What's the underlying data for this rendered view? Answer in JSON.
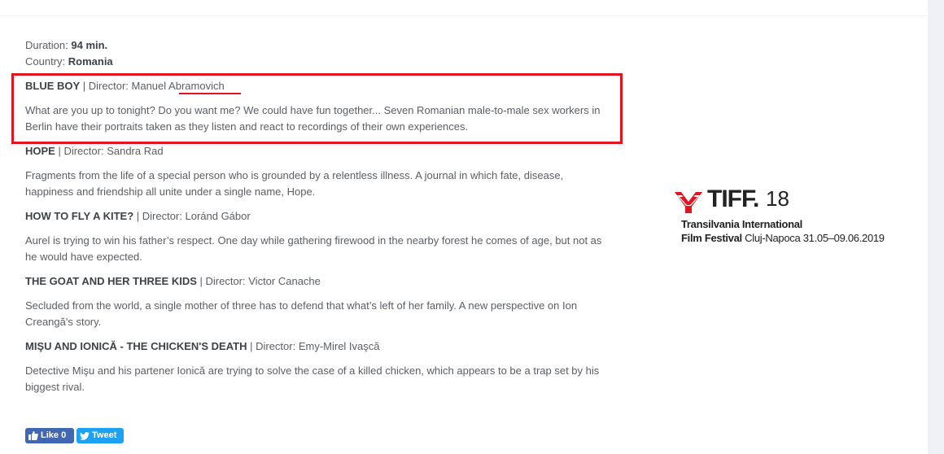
{
  "info": {
    "duration_label": "Duration:",
    "duration_value": "94 min.",
    "country_label": "Country:",
    "country_value": "Romania"
  },
  "films": [
    {
      "name": "BLUE BOY",
      "director_label": " | Director: ",
      "director": "Manuel Abramovich",
      "description": "What are you up to tonight? Do you want me? We could have fun together... Seven Romanian male-to-male sex workers in Berlin have their portraits taken as they listen and react to recordings of their own experiences."
    },
    {
      "name": "HOPE",
      "director_label": " | Director: ",
      "director": "Sandra Rad",
      "description": "Fragments from the life of a special person who is grounded by a relentless illness. A journal in which fate, disease, happiness and friendship all unite under a single name, Hope."
    },
    {
      "name": "HOW TO FLY A KITE?",
      "director_label": " | Director: ",
      "director": "Loránd Gábor",
      "description": "Aurel is trying to win his father’s respect. One day while gathering firewood in the nearby forest he comes of age, but not as he would have expected."
    },
    {
      "name": "THE GOAT AND HER THREE KIDS",
      "director_label": " | Director: ",
      "director": "Victor Canache",
      "description": "Secluded from the world, a single mother of three has to defend that what’s left of her family. A new perspective on Ion Creangă's story."
    },
    {
      "name": "MIŞU AND IONICĂ - THE CHICKEN'S DEATH",
      "director_label": " | Director: ",
      "director": "Emy-Mirel Ivaşcă",
      "description": "Detective Mişu and his partener Ionică are trying to solve the case of a killed chicken, which appears to be a trap set by his biggest rival."
    }
  ],
  "logo": {
    "brand": "TIFF.",
    "edition": "18",
    "line1": "Transilvania International",
    "line2_bold": "Film Festival",
    "line2_rest": " Cluj-Napoca 31.05–09.06.2019"
  },
  "share": {
    "like_label": "Like 0",
    "tweet_label": "Tweet"
  },
  "colors": {
    "highlight": "#e3141f",
    "facebook": "#4267b2",
    "twitter": "#1da1f2"
  }
}
